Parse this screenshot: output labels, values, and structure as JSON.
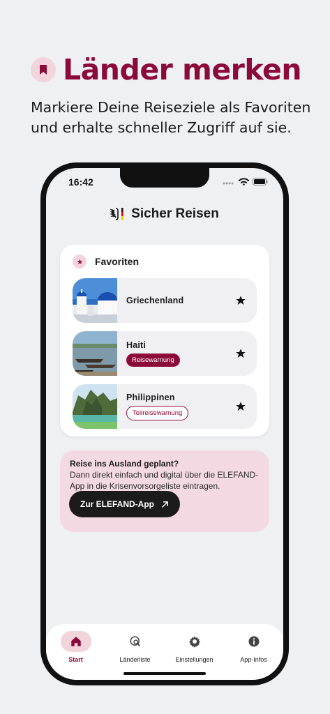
{
  "promo": {
    "title": "Länder merken",
    "subtitle": "Markiere Deine Reiseziele als Favoriten und erhalte schneller Zugriff auf sie.",
    "icon": "bookmark-icon",
    "accent_color": "#8c0a3a"
  },
  "status_bar": {
    "time": "16:42",
    "icons": [
      "signal-icon",
      "wifi-icon",
      "battery-icon"
    ]
  },
  "app": {
    "title": "Sicher Reisen",
    "logo": "federal-eagle-icon"
  },
  "favorites": {
    "title": "Favoriten",
    "icon": "star-icon",
    "items": [
      {
        "name": "Griechenland",
        "badge": null,
        "image": "santorini-photo"
      },
      {
        "name": "Haiti",
        "badge": "Reisewarnung",
        "badge_style": "filled",
        "image": "boats-beach-photo"
      },
      {
        "name": "Philippinen",
        "badge": "Teilreisewarnung",
        "badge_style": "outline",
        "image": "lagoon-cliffs-photo"
      }
    ]
  },
  "elefand": {
    "title": "Reise ins Ausland geplant?",
    "text": "Dann direkt einfach und digital über die ELEFAND-App in die Krisenvorsorgeliste eintragen.",
    "button": "Zur ELEFAND-App"
  },
  "tabs": [
    {
      "label": "Start",
      "icon": "home-icon",
      "active": true
    },
    {
      "label": "Länderliste",
      "icon": "globe-search-icon",
      "active": false
    },
    {
      "label": "Einstellungen",
      "icon": "gear-icon",
      "active": false
    },
    {
      "label": "App-Infos",
      "icon": "info-icon",
      "active": false
    }
  ]
}
